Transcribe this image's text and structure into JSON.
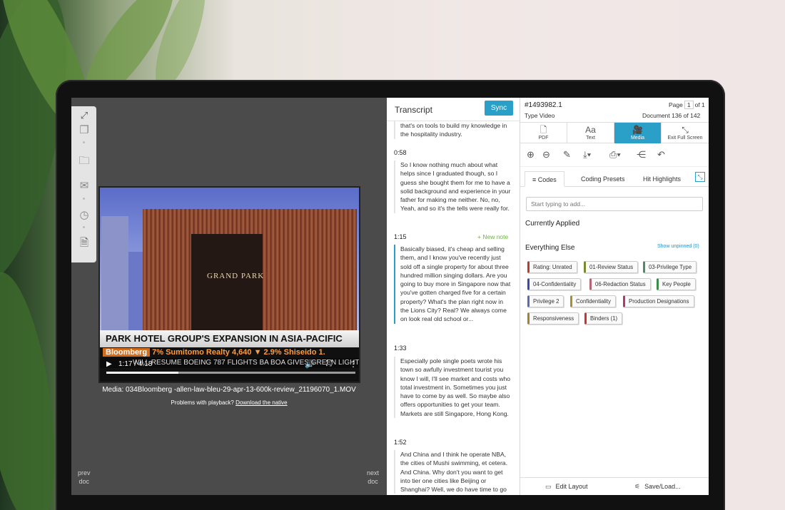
{
  "viewer": {
    "rail_icons": [
      "expand-icon",
      "copy-icon",
      "folder-icon",
      "mail-icon",
      "clock-icon",
      "document-icon"
    ],
    "video": {
      "building_text": "GRAND PARK",
      "headline": "PARK HOTEL GROUP'S EXPANSION IN ASIA-PACIFIC",
      "ticker_brand": "Bloomberg",
      "ticker": "7%  Sumitomo Realty  4,640  ▼ 2.9%  Shiseido  1.",
      "ticker_lower": "WILL RESUME BOEING 787 FLIGHTS   BA BOA GIVES GREEN LIGHT",
      "time": "1:17 / 4:18",
      "progress": 0.29
    },
    "caption": "Media: 034Bloomberg -allen-law-bleu-29-apr-13-600k-review_21196070_1.MOV",
    "playback_prefix": "Problems with playback? ",
    "playback_link": "Download the native",
    "prev_label_1": "prev",
    "prev_label_2": "doc",
    "next_label_1": "next",
    "next_label_2": "doc"
  },
  "transcript": {
    "title": "Transcript",
    "sync_label": "Sync",
    "new_note": "+ New note",
    "segments": [
      {
        "time": "",
        "text": "that's on tools to build my knowledge in the hospitality industry."
      },
      {
        "time": "0:58",
        "text": "So I know nothing much about what helps since I graduated though, so I guess she bought them for me to have a solid background and experience in your father for making me neither. No, no, Yeah, and so it's the tells were really for."
      },
      {
        "time": "1:15",
        "text": "Basically biased, it's cheap and selling them, and I know you've recently just sold off a single property for about three hundred million singing dollars. Are you going to buy more in Singapore now that you've gotten charged five for a certain property? What's the plan right now in the Lions City? Real? We always come on look real old school or..."
      },
      {
        "time": "1:33",
        "text": "Especially pole single poets wrote his town so awfully investment tourist you know I will, I'll see market and costs who total investment in. Sometimes you just have to come by as well. So maybe also offers opportunities to get your team. Markets are still Singapore, Hong Kong."
      },
      {
        "time": "1:52",
        "text": "And China and I think he operate NBA, the cities of Mushi swimming, et cetera. And China. Why don't you want to get into tier one cities like Beijing or Shanghai? Well, we do have time to go"
      }
    ]
  },
  "panel": {
    "doc_id": "#1493982.1",
    "doc_type": "Type Video",
    "page_label": "Page",
    "page_value": "1",
    "page_of": "of 1",
    "doc_count": "Document 136 of 142",
    "tabs": [
      {
        "label": "PDF",
        "icon": "pdf-icon",
        "glyph": "🗋"
      },
      {
        "label": "Text",
        "icon": "text-icon",
        "glyph": "Aa"
      },
      {
        "label": "Media",
        "icon": "media-icon",
        "glyph": "🎥"
      },
      {
        "label": "Exit Full Screen",
        "icon": "exit-fullscreen-icon",
        "glyph": "⤡"
      }
    ],
    "toolbar_icons": [
      "zoom-in-icon",
      "zoom-out-icon",
      "pen-icon",
      "download-icon",
      "print-icon",
      "share-icon",
      "undo-icon"
    ],
    "subtabs": {
      "codes": "Codes",
      "presets": "Coding Presets",
      "highlights": "Hit Highlights"
    },
    "search_placeholder": "Start typing to add...",
    "currently_applied": "Currently Applied",
    "everything_else": "Everything Else",
    "show_unpinned": "Show unpinned (0)",
    "codes": [
      {
        "label": "Rating: Unrated",
        "color": "#c0392b"
      },
      {
        "label": "01-Review Status",
        "color": "#7a8a2a"
      },
      {
        "label": "03-Privilege Type",
        "color": "#4e8a6a"
      },
      {
        "label": "04-Confidentiality",
        "color": "#3a4aa8"
      },
      {
        "label": "06-Redaction Status",
        "color": "#b5656f"
      },
      {
        "label": "Key People",
        "color": "#3a8a4a"
      },
      {
        "label": "Privilege 2",
        "color": "#5a6ab8"
      },
      {
        "label": "Confidentiality",
        "color": "#a6912e"
      },
      {
        "label": "Production Designations",
        "color": "#b5386b"
      },
      {
        "label": "Responsiveness",
        "color": "#a6812e"
      },
      {
        "label": "Binders (1)",
        "color": "#d03030"
      }
    ],
    "footer": {
      "edit_layout": "Edit Layout",
      "save_load": "Save/Load..."
    }
  }
}
